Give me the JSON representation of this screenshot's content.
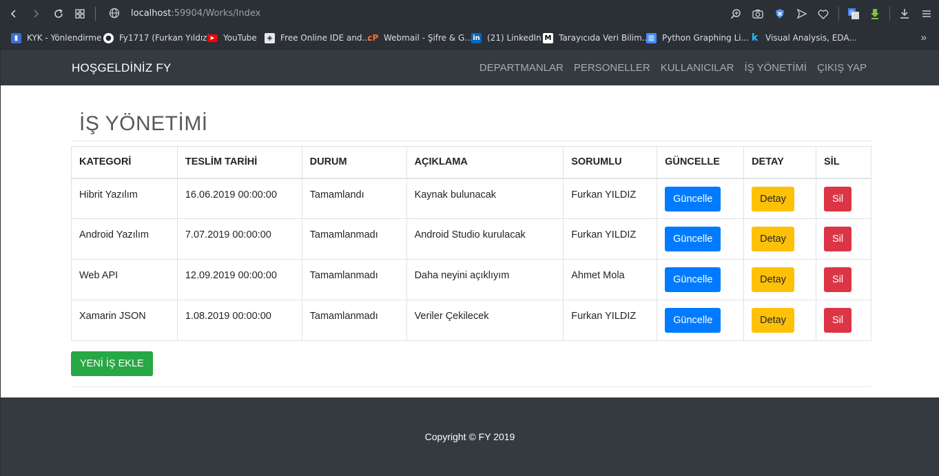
{
  "browser": {
    "url_host": "localhost",
    "url_rest": ":59904/Works/Index",
    "bookmarks": [
      {
        "label": "KYK - Yönlendirme",
        "icon": "kyk-icon",
        "color": "#3b6fd1"
      },
      {
        "label": "Fy1717 (Furkan Yıldız)",
        "icon": "github-icon",
        "color": "#ffffff"
      },
      {
        "label": "YouTube",
        "icon": "youtube-icon",
        "color": "#ff0000"
      },
      {
        "label": "Free Online IDE and...",
        "icon": "ide-icon",
        "color": "#ffffff"
      },
      {
        "label": "Webmail - Şifre & G...",
        "icon": "cpanel-icon",
        "color": "#ff6c2c"
      },
      {
        "label": "(21) LinkedIn",
        "icon": "linkedin-icon",
        "color": "#0a66c2"
      },
      {
        "label": "Tarayıcıda Veri Bilim...",
        "icon": "medium-icon",
        "color": "#ffffff"
      },
      {
        "label": "Python Graphing Li...",
        "icon": "plotly-icon",
        "color": "#3f8ff5"
      },
      {
        "label": "Visual Analysis, EDA...",
        "icon": "kaggle-icon",
        "color": "#20beff"
      }
    ]
  },
  "navbar": {
    "brand": "HOŞGELDİNİZ FY",
    "links": [
      "DEPARTMANLAR",
      "PERSONELLER",
      "KULLANICILAR",
      "İŞ YÖNETİMİ",
      "ÇIKIŞ YAP"
    ]
  },
  "main": {
    "title": "İŞ YÖNETİMİ",
    "table": {
      "headers": [
        "KATEGORİ",
        "TESLİM TARİHİ",
        "DURUM",
        "AÇIKLAMA",
        "SORUMLU",
        "GÜNCELLE",
        "DETAY",
        "SİL"
      ],
      "rows": [
        {
          "category": "Hibrit Yazılım",
          "date": "16.06.2019 00:00:00",
          "status": "Tamamlandı",
          "description": "Kaynak bulunacak",
          "owner": "Furkan YILDIZ"
        },
        {
          "category": "Android Yazılım",
          "date": "7.07.2019 00:00:00",
          "status": "Tamamlanmadı",
          "description": "Android Studio kurulacak",
          "owner": "Furkan YILDIZ"
        },
        {
          "category": "Web API",
          "date": "12.09.2019 00:00:00",
          "status": "Tamamlanmadı",
          "description": "Daha neyini açıklıyım",
          "owner": "Ahmet Mola"
        },
        {
          "category": "Xamarin JSON",
          "date": "1.08.2019 00:00:00",
          "status": "Tamamlanmadı",
          "description": "Veriler Çekilecek",
          "owner": "Furkan YILDIZ"
        }
      ],
      "update_label": "Güncelle",
      "detail_label": "Detay",
      "delete_label": "Sil"
    },
    "add_button": "YENİ İŞ EKLE"
  },
  "footer": {
    "copyright": "Copyright © FY 2019"
  },
  "colors": {
    "navbar": "#343a40",
    "primary": "#007bff",
    "warning": "#ffc107",
    "danger": "#dc3545",
    "success": "#28a745"
  }
}
